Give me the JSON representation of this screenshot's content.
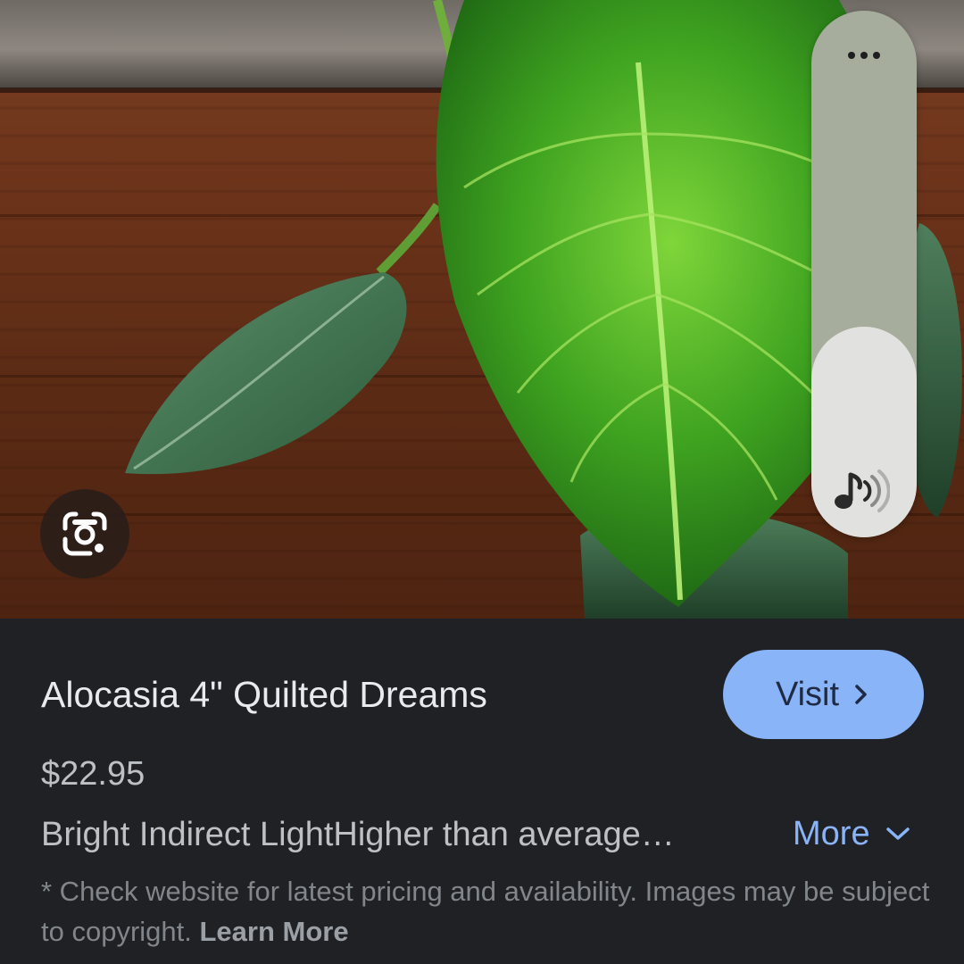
{
  "product": {
    "title": "Alocasia 4\" Quilted Dreams",
    "price": "$22.95",
    "description": "Bright Indirect LightHigher than average…",
    "visit_label": "Visit",
    "more_label": "More",
    "disclaimer": "* Check website for latest pricing and availability. Images may be subject to copyright.",
    "learn_more_label": "Learn More"
  },
  "volume": {
    "level": 0.4,
    "icon": "music-note-volume-icon",
    "options_icon": "more-horizontal-icon"
  },
  "icons": {
    "lens": "google-lens-icon",
    "visit_chevron": "chevron-right-icon",
    "more_chevron": "chevron-down-icon"
  },
  "colors": {
    "panel_bg": "#202124",
    "accent": "#8ab4f8",
    "volume_track": "#a7ad9d",
    "volume_fill": "#e1e2df"
  }
}
